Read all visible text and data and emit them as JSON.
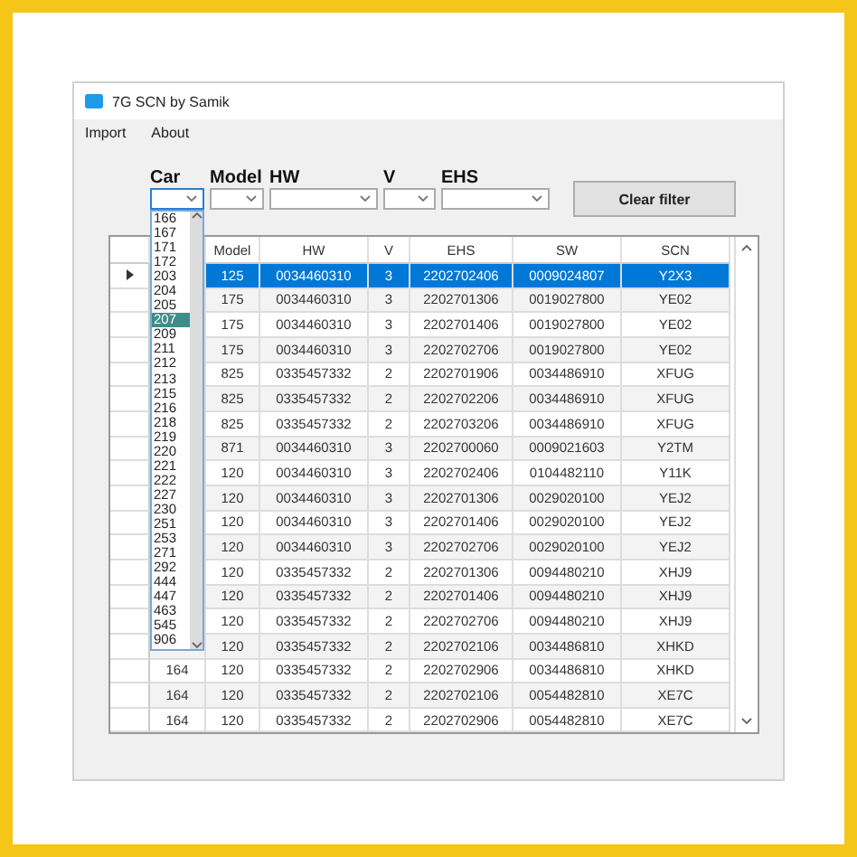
{
  "window": {
    "title": "7G SCN by Samik"
  },
  "menu": [
    "Import",
    "About"
  ],
  "filters": [
    {
      "label": "Car",
      "focused": true,
      "open": true
    },
    {
      "label": "Model",
      "focused": false,
      "open": false
    },
    {
      "label": "HW",
      "focused": false,
      "open": false
    },
    {
      "label": "V",
      "focused": false,
      "open": false
    },
    {
      "label": "EHS",
      "focused": false,
      "open": false
    }
  ],
  "dropdown": {
    "items": [
      {
        "text": "166",
        "selected": false
      },
      {
        "text": "167",
        "selected": false
      },
      {
        "text": "171",
        "selected": false
      },
      {
        "text": "172",
        "selected": false
      },
      {
        "text": "203",
        "selected": false
      },
      {
        "text": "204",
        "selected": false
      },
      {
        "text": "205",
        "selected": false
      },
      {
        "text": "207",
        "selected": true
      },
      {
        "text": "209",
        "selected": false
      },
      {
        "text": "211",
        "selected": false
      },
      {
        "text": "212",
        "selected": false
      },
      {
        "text": "213",
        "selected": false
      },
      {
        "text": "215",
        "selected": false
      },
      {
        "text": "216",
        "selected": false
      },
      {
        "text": "218",
        "selected": false
      },
      {
        "text": "219",
        "selected": false
      },
      {
        "text": "220",
        "selected": false
      },
      {
        "text": "221",
        "selected": false
      },
      {
        "text": "222",
        "selected": false
      },
      {
        "text": "227",
        "selected": false
      },
      {
        "text": "230",
        "selected": false
      },
      {
        "text": "251",
        "selected": false
      },
      {
        "text": "253",
        "selected": false
      },
      {
        "text": "271",
        "selected": false
      },
      {
        "text": "292",
        "selected": false
      },
      {
        "text": "444",
        "selected": false
      },
      {
        "text": "447",
        "selected": false
      },
      {
        "text": "463",
        "selected": false
      },
      {
        "text": "545",
        "selected": false
      },
      {
        "text": "906",
        "selected": false
      }
    ]
  },
  "clear_button": "Clear filter",
  "table": {
    "columns": [
      "Model",
      "HW",
      "V",
      "EHS",
      "SW",
      "SCN"
    ],
    "rows": [
      {
        "selected": true,
        "cells": [
          "125",
          "0034460310",
          "3",
          "2202702406",
          "0009024807",
          "Y2X3"
        ]
      },
      {
        "selected": false,
        "cells": [
          "175",
          "0034460310",
          "3",
          "2202701306",
          "0019027800",
          "YE02"
        ]
      },
      {
        "selected": false,
        "cells": [
          "175",
          "0034460310",
          "3",
          "2202701406",
          "0019027800",
          "YE02"
        ]
      },
      {
        "selected": false,
        "cells": [
          "175",
          "0034460310",
          "3",
          "2202702706",
          "0019027800",
          "YE02"
        ]
      },
      {
        "selected": false,
        "cells": [
          "825",
          "0335457332",
          "2",
          "2202701906",
          "0034486910",
          "XFUG"
        ]
      },
      {
        "selected": false,
        "cells": [
          "825",
          "0335457332",
          "2",
          "2202702206",
          "0034486910",
          "XFUG"
        ]
      },
      {
        "selected": false,
        "cells": [
          "825",
          "0335457332",
          "2",
          "2202703206",
          "0034486910",
          "XFUG"
        ]
      },
      {
        "selected": false,
        "cells": [
          "871",
          "0034460310",
          "3",
          "2202700060",
          "0009021603",
          "Y2TM"
        ]
      },
      {
        "selected": false,
        "cells": [
          "120",
          "0034460310",
          "3",
          "2202702406",
          "0104482110",
          "Y11K"
        ]
      },
      {
        "selected": false,
        "cells": [
          "120",
          "0034460310",
          "3",
          "2202701306",
          "0029020100",
          "YEJ2"
        ]
      },
      {
        "selected": false,
        "cells": [
          "120",
          "0034460310",
          "3",
          "2202701406",
          "0029020100",
          "YEJ2"
        ]
      },
      {
        "selected": false,
        "cells": [
          "120",
          "0034460310",
          "3",
          "2202702706",
          "0029020100",
          "YEJ2"
        ]
      },
      {
        "selected": false,
        "cells": [
          "120",
          "0335457332",
          "2",
          "2202701306",
          "0094480210",
          "XHJ9"
        ]
      },
      {
        "selected": false,
        "cells": [
          "120",
          "0335457332",
          "2",
          "2202701406",
          "0094480210",
          "XHJ9"
        ]
      },
      {
        "selected": false,
        "cells": [
          "120",
          "0335457332",
          "2",
          "2202702706",
          "0094480210",
          "XHJ9"
        ]
      },
      {
        "selected": false,
        "cells": [
          "120",
          "0335457332",
          "2",
          "2202702106",
          "0034486810",
          "XHKD"
        ]
      },
      {
        "selected": false,
        "car": "164",
        "cells": [
          "120",
          "0335457332",
          "2",
          "2202702906",
          "0034486810",
          "XHKD"
        ]
      },
      {
        "selected": false,
        "car": "164",
        "cells": [
          "120",
          "0335457332",
          "2",
          "2202702106",
          "0054482810",
          "XE7C"
        ]
      },
      {
        "selected": false,
        "car": "164",
        "cells": [
          "120",
          "0335457332",
          "2",
          "2202702906",
          "0054482810",
          "XE7C"
        ]
      }
    ]
  }
}
